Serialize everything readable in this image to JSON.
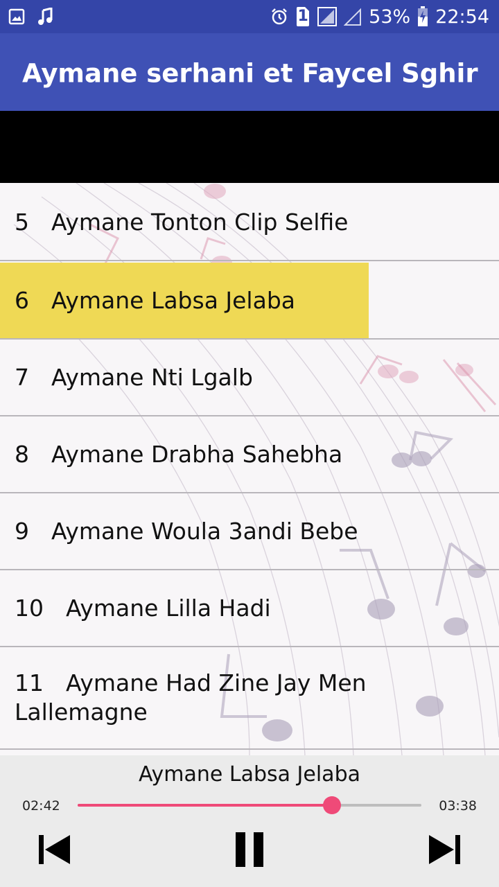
{
  "status_bar": {
    "battery": "53%",
    "time": "22:54",
    "sim_badge": "1",
    "icons": [
      "image-icon",
      "music-note-icon",
      "alarm-icon",
      "sim-icon",
      "signal-icon",
      "signal-empty-icon",
      "battery-charging-icon"
    ]
  },
  "app_bar": {
    "title": "Aymane serhani et Faycel Sghir"
  },
  "songs": [
    {
      "num": "5",
      "title": "Aymane Tonton Clip Selfie"
    },
    {
      "num": "6",
      "title": "Aymane Labsa Jelaba",
      "selected": true
    },
    {
      "num": "7",
      "title": "Aymane Nti Lgalb"
    },
    {
      "num": "8",
      "title": "Aymane Drabha Sahebha"
    },
    {
      "num": "9",
      "title": "Aymane Woula 3andi Bebe"
    },
    {
      "num": "10",
      "title": "Aymane Lilla Hadi"
    },
    {
      "num": "11",
      "title": "Aymane Had Zine Jay Men Lallemagne"
    }
  ],
  "player": {
    "now_playing": "Aymane Labsa Jelaba",
    "current_time": "02:42",
    "total_time": "03:38",
    "progress": 0.74,
    "controls": [
      "skip-previous-icon",
      "pause-icon",
      "skip-next-icon"
    ]
  },
  "colors": {
    "status_bar": "#3445a8",
    "app_bar": "#3f51b5",
    "highlight": "#efd955",
    "accent": "#ef4a78"
  }
}
